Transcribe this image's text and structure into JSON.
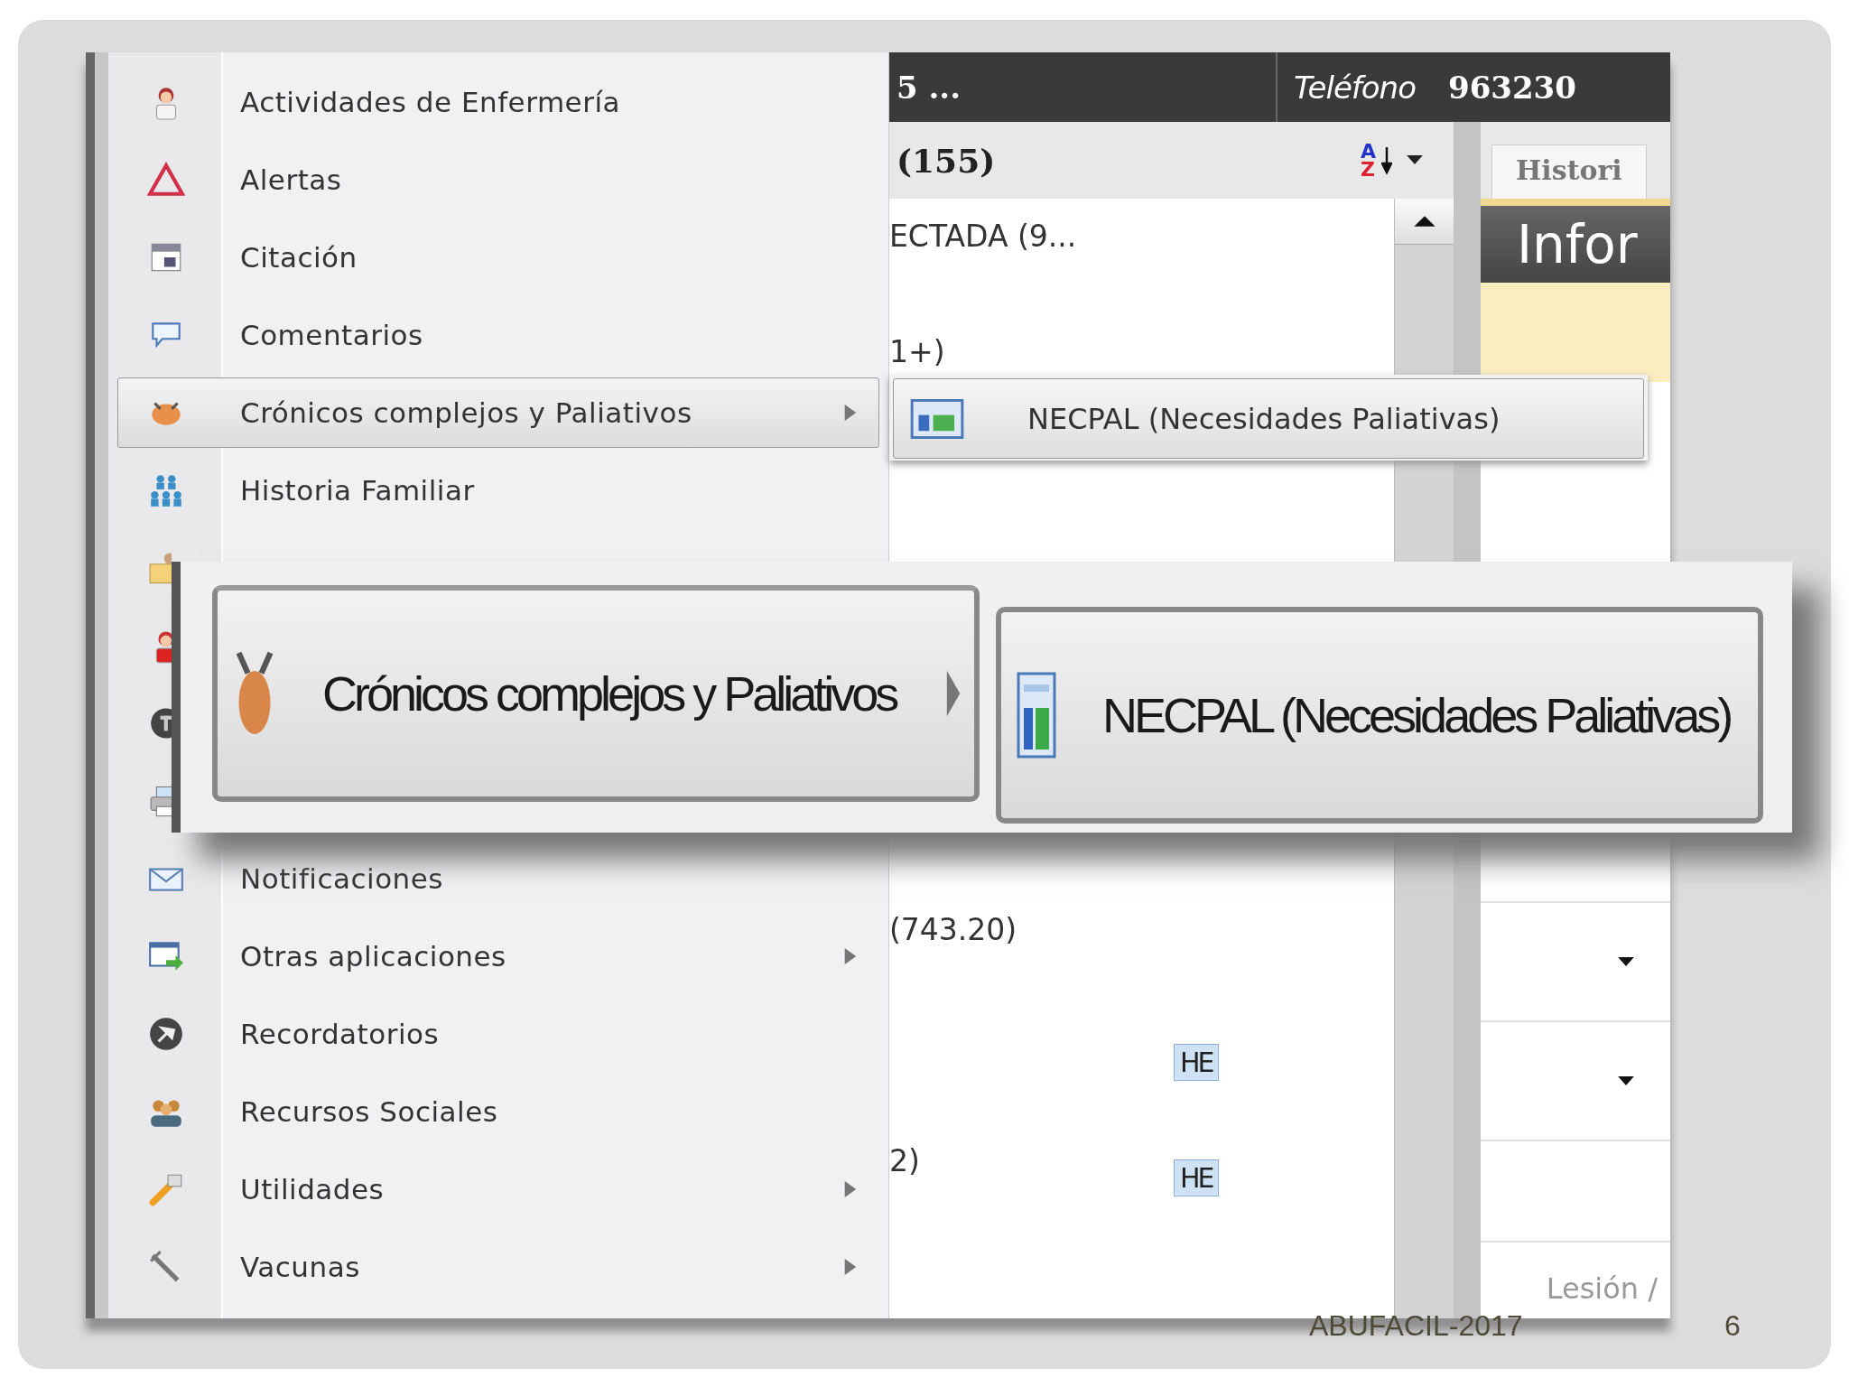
{
  "menu": {
    "items": [
      {
        "label": "Actividades de Enfermería",
        "submenu": false,
        "selected": false
      },
      {
        "label": "Alertas",
        "submenu": false,
        "selected": false
      },
      {
        "label": "Citación",
        "submenu": false,
        "selected": false
      },
      {
        "label": "Comentarios",
        "submenu": false,
        "selected": false
      },
      {
        "label": "Crónicos complejos y Paliativos",
        "submenu": true,
        "selected": true
      },
      {
        "label": "Historia Familiar",
        "submenu": false,
        "selected": false
      },
      {
        "label": "Notificaciones",
        "submenu": false,
        "selected": false
      },
      {
        "label": "Otras aplicaciones",
        "submenu": true,
        "selected": false
      },
      {
        "label": "Recordatorios",
        "submenu": false,
        "selected": false
      },
      {
        "label": "Recursos Sociales",
        "submenu": false,
        "selected": false
      },
      {
        "label": "Utilidades",
        "submenu": true,
        "selected": false
      },
      {
        "label": "Vacunas",
        "submenu": true,
        "selected": false
      }
    ]
  },
  "submenu": {
    "items": [
      {
        "label": "NECPAL (Necesidades Paliativas)",
        "selected": true
      }
    ]
  },
  "header": {
    "left": "5 ...",
    "phone_label": "Teléfono",
    "phone": "963230"
  },
  "toolbar": {
    "count": "(155)",
    "sort_top": "A",
    "sort_bottom": "Z"
  },
  "list": {
    "rows": [
      {
        "text": "ECTADA (9..."
      },
      {
        "text": "1+)"
      },
      {
        "text": "(743.20)"
      },
      {
        "badge": "HE"
      },
      {
        "text": "2)",
        "badge": "HE"
      }
    ]
  },
  "right_panel": {
    "tab": "Histori",
    "title": "Infor",
    "footer_label": "Lesión /"
  },
  "zoom_inset": {
    "menu_item": {
      "label": "Crónicos complejos y Paliativos",
      "submenu": true,
      "selected": true
    },
    "submenu_item": {
      "label": "NECPAL (Necesidades Paliativas)",
      "selected": true
    }
  },
  "slide_footer": {
    "text": "ABUFACIL-2017",
    "page": "6"
  }
}
